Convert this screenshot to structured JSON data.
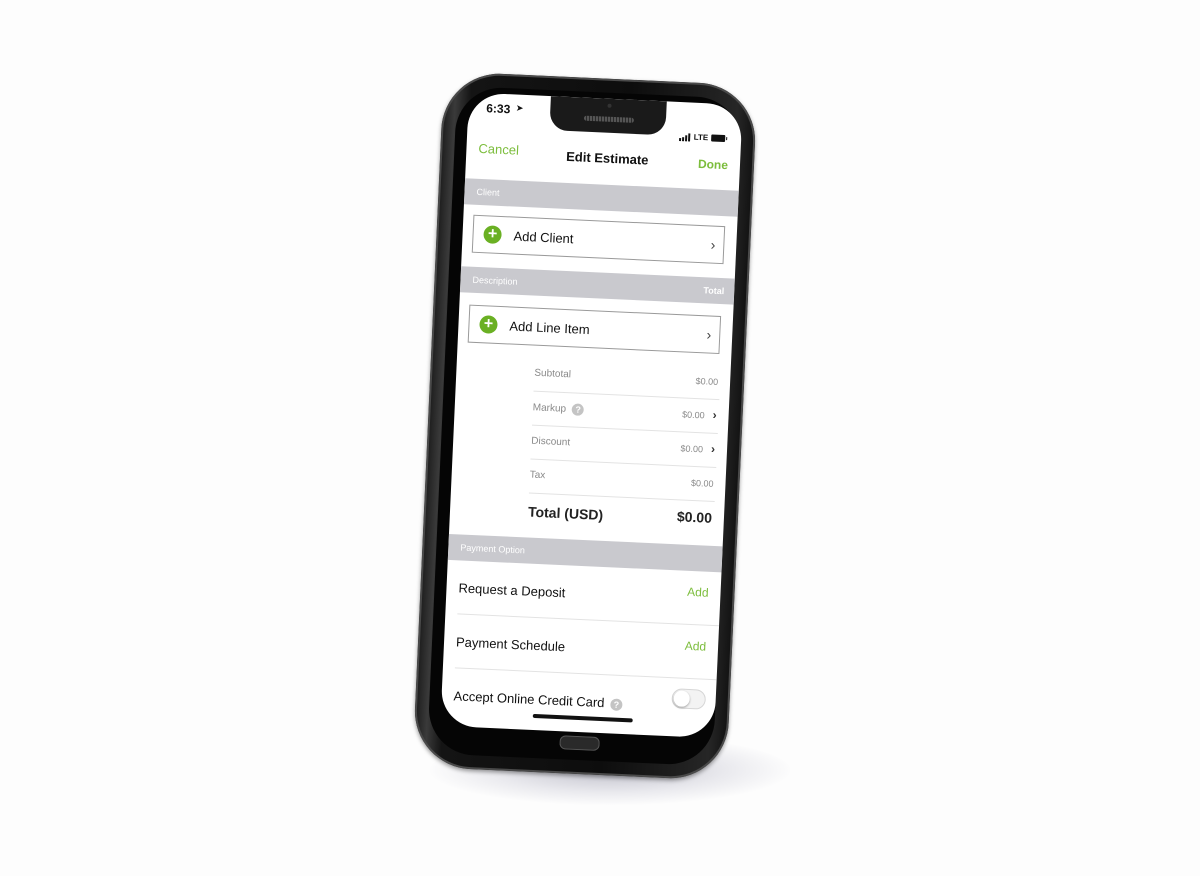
{
  "status_bar": {
    "time": "6:33",
    "location_icon": "location-arrow-icon",
    "network": "LTE",
    "signal_icon": "signal-bars-icon",
    "battery_icon": "battery-icon"
  },
  "nav": {
    "cancel_label": "Cancel",
    "title": "Edit Estimate",
    "done_label": "Done"
  },
  "client_section": {
    "header": "Client",
    "add_label": "Add Client"
  },
  "line_items_section": {
    "header": "Description",
    "header_right": "Total",
    "add_label": "Add Line Item"
  },
  "summary": {
    "subtotal_label": "Subtotal",
    "subtotal_value": "$0.00",
    "markup_label": "Markup",
    "markup_value": "$0.00",
    "discount_label": "Discount",
    "discount_value": "$0.00",
    "tax_label": "Tax",
    "tax_value": "$0.00",
    "total_label": "Total (USD)",
    "total_value": "$0.00"
  },
  "payment_section": {
    "header": "Payment Option",
    "deposit_label": "Request a Deposit",
    "deposit_action": "Add",
    "schedule_label": "Payment Schedule",
    "schedule_action": "Add",
    "credit_card_label": "Accept Online Credit Card",
    "credit_card_enabled": false
  },
  "colors": {
    "accent": "#7cbd3c",
    "plus_button": "#6ab023",
    "section_header_bg": "#c9c9ce"
  }
}
